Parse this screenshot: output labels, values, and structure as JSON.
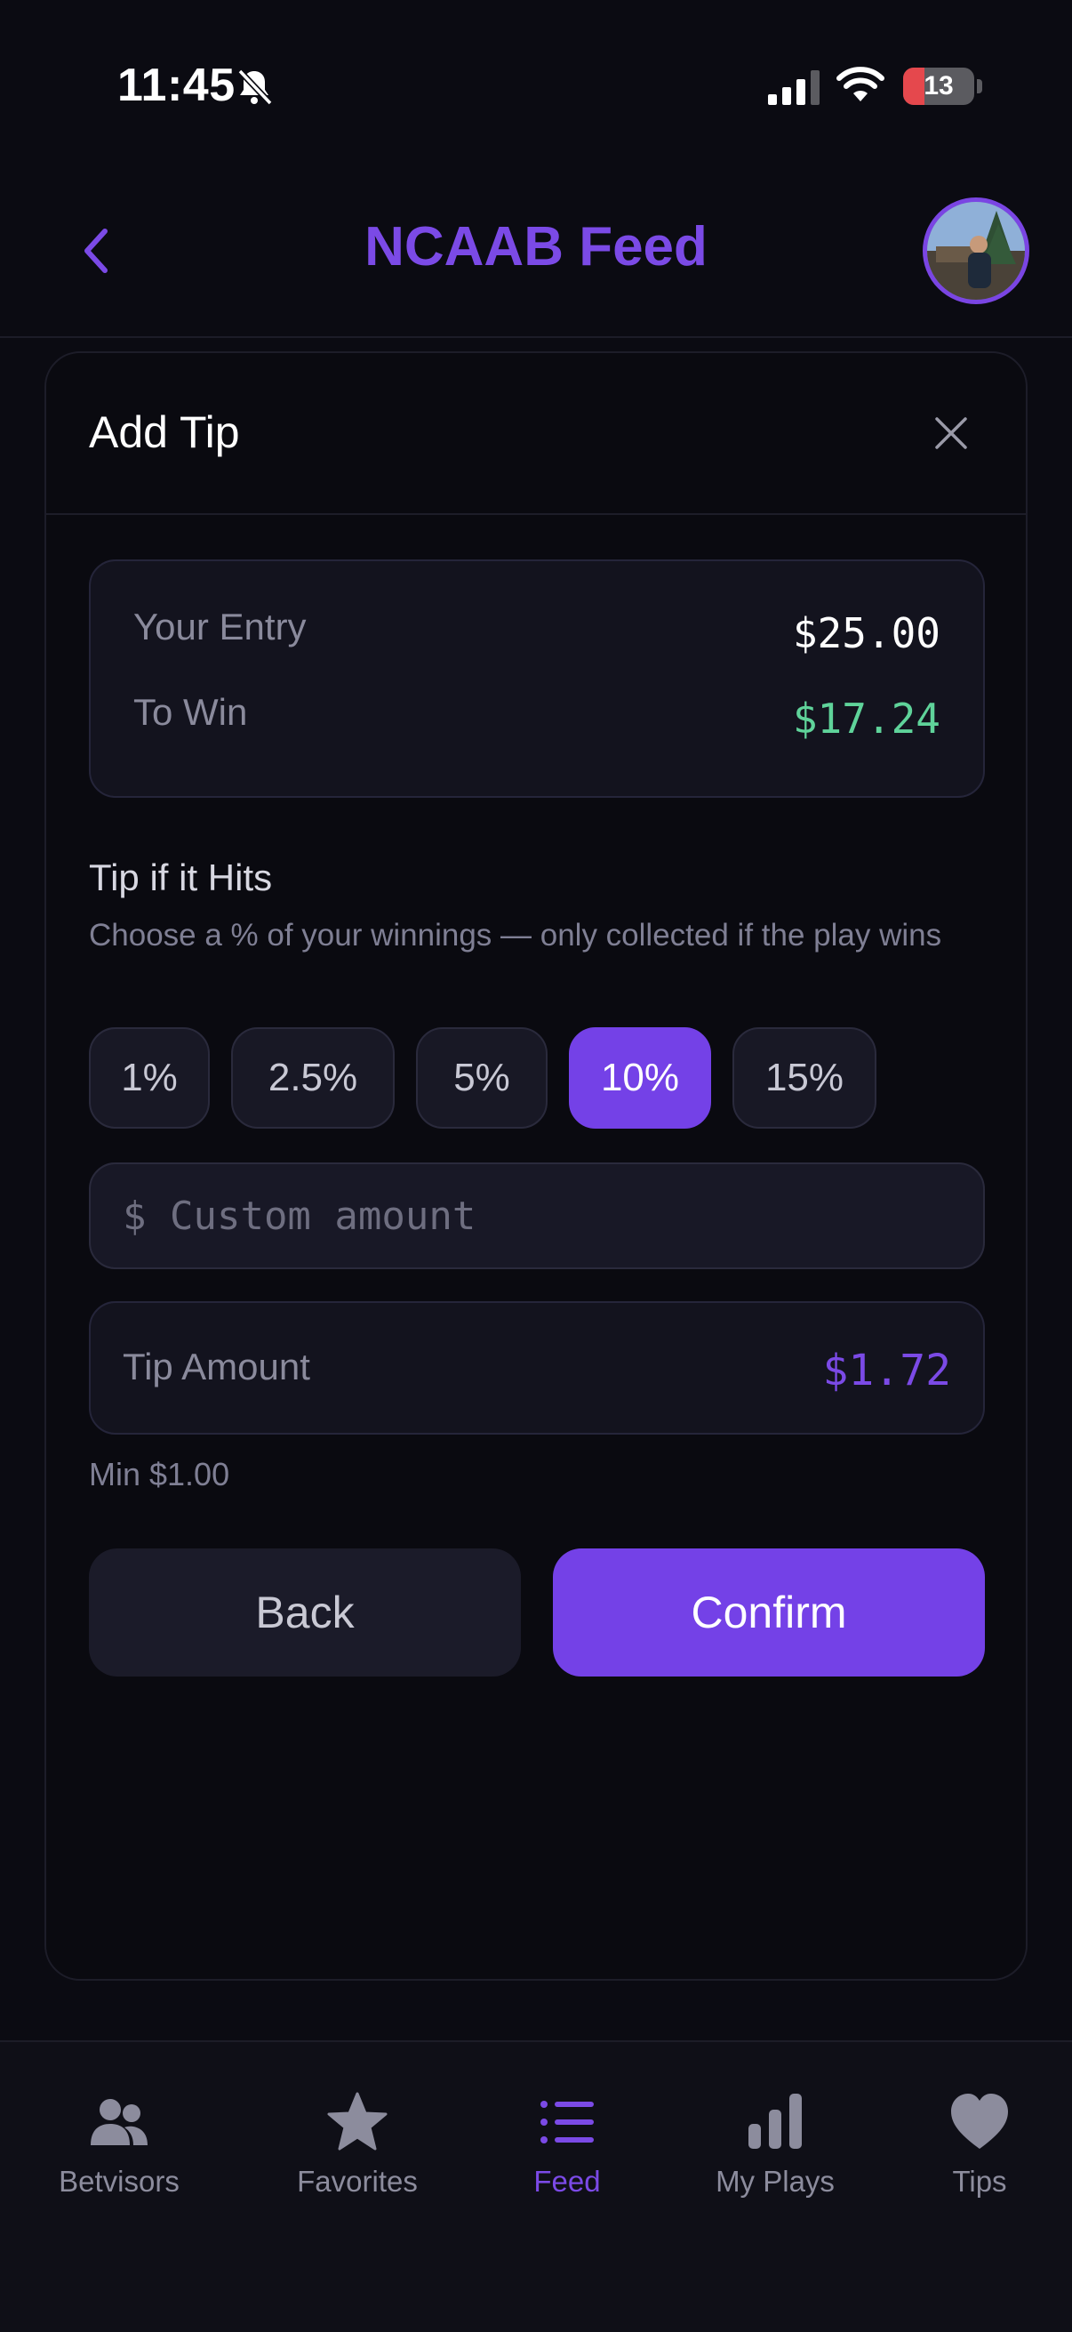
{
  "status_bar": {
    "time": "11:45",
    "battery": "13",
    "battery_level": 0.13
  },
  "header": {
    "title": "NCAAB Feed"
  },
  "modal": {
    "title": "Add Tip",
    "summary": {
      "entry_label": "Your Entry",
      "entry_value": "$25.00",
      "win_label": "To Win",
      "win_value": "$17.24"
    },
    "tip_section": {
      "title": "Tip if it Hits",
      "description": "Choose a % of your winnings — only collected if the play wins",
      "options": [
        "1%",
        "2.5%",
        "5%",
        "10%",
        "15%"
      ],
      "selected_option": "10%",
      "custom_placeholder": "$ Custom amount",
      "custom_value": ""
    },
    "tip_amount": {
      "label": "Tip Amount",
      "value": "$1.72"
    },
    "min_note": "Min $1.00",
    "back_label": "Back",
    "confirm_label": "Confirm"
  },
  "nav": {
    "items": [
      {
        "label": "Betvisors",
        "icon": "users-icon"
      },
      {
        "label": "Favorites",
        "icon": "star-icon"
      },
      {
        "label": "Feed",
        "icon": "list-icon"
      },
      {
        "label": "My Plays",
        "icon": "bar-chart-icon"
      },
      {
        "label": "Tips",
        "icon": "heart-icon"
      }
    ],
    "active": "Feed"
  },
  "colors": {
    "accent": "#7441e7",
    "win_green": "#5fd39a",
    "background": "#0b0b12"
  }
}
